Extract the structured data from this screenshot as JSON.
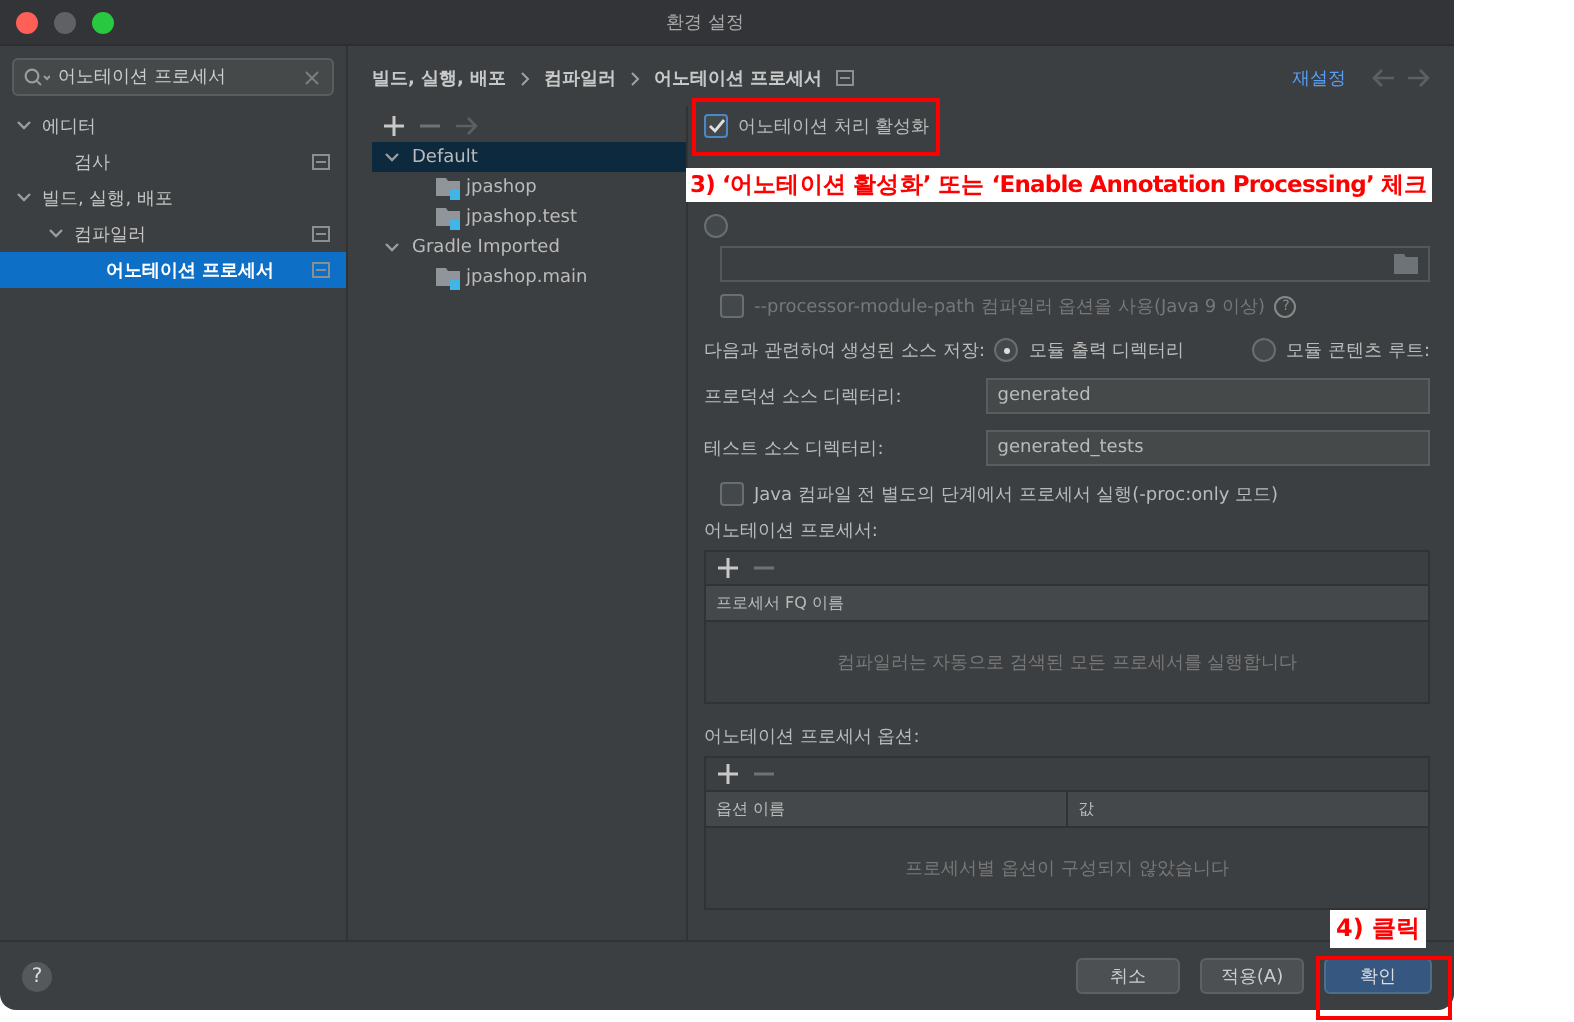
{
  "window": {
    "title": "환경 설정"
  },
  "search": {
    "value": "어노테이션 프로세서"
  },
  "sidebar": {
    "items": [
      {
        "label": "에디터",
        "expanded": true,
        "selected": false,
        "children": [
          {
            "label": "검사",
            "selected": false
          }
        ]
      },
      {
        "label": "빌드, 실행, 배포",
        "expanded": true,
        "selected": false,
        "children": [
          {
            "label": "컴파일러",
            "expanded": true,
            "selected": false,
            "children": [
              {
                "label": "어노테이션 프로세서",
                "selected": true
              }
            ]
          }
        ]
      }
    ]
  },
  "breadcrumb": [
    "빌드, 실행, 배포",
    "컴파일러",
    "어노테이션 프로세서"
  ],
  "reset_link": "재설정",
  "profiles": [
    {
      "label": "Default",
      "expanded": true,
      "selected": true,
      "children": [
        {
          "label": "jpashop",
          "selected": false
        },
        {
          "label": "jpashop.test",
          "selected": false
        }
      ]
    },
    {
      "label": "Gradle Imported",
      "expanded": true,
      "selected": false,
      "children": [
        {
          "label": "jpashop.main",
          "selected": false
        }
      ]
    }
  ],
  "enable_checkbox": {
    "label": "어노테이션 처리 활성화",
    "checked": true
  },
  "processor_path_radio": {
    "selected": false
  },
  "module_path_checkbox": {
    "label": "--processor-module-path 컴파일러 옵션을 사용(Java 9 이상)",
    "checked": false,
    "help": "?"
  },
  "store_row": {
    "label": "다음과 관련하여 생성된 소스 저장:",
    "options": [
      {
        "label": "모듈 출력 디렉터리",
        "selected": true
      },
      {
        "label": "모듈 콘텐츠 루트:",
        "selected": false
      }
    ]
  },
  "production_dir": {
    "label": "프로덕션 소스 디렉터리:",
    "value": "generated"
  },
  "test_dir": {
    "label": "테스트 소스 디렉터리:",
    "value": "generated_tests"
  },
  "proc_only_checkbox": {
    "label": "Java 컴파일 전 별도의 단계에서 프로세서 실행(-proc:only 모드)",
    "checked": false
  },
  "processors": {
    "title": "어노테이션 프로세서:",
    "columns": [
      "프로세서 FQ 이름"
    ],
    "empty_text": "컴파일러는 자동으로 검색된 모든 프로세서를 실행합니다"
  },
  "options": {
    "title": "어노테이션 프로세서 옵션:",
    "columns": [
      "옵션 이름",
      "값"
    ],
    "empty_text": "프로세서별 옵션이 구성되지 않았습니다"
  },
  "help_button": "?",
  "buttons": [
    {
      "label": "취소",
      "kind": "normal"
    },
    {
      "label": "적용(A)",
      "kind": "normal"
    },
    {
      "label": "확인",
      "kind": "default"
    }
  ],
  "annotations": [
    {
      "text": "3) ‘어노테이션 활성화’ 또는 ‘Enable Annotation Processing’ 체크"
    },
    {
      "text": "4) 클릭"
    }
  ]
}
